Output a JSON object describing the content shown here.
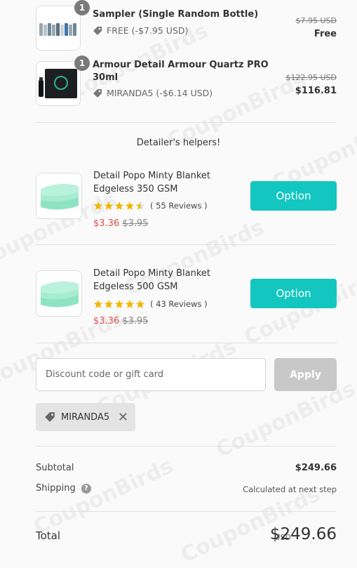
{
  "order_items": [
    {
      "qty": "1",
      "title": "Sampler (Single Random Bottle)",
      "discount": "FREE (-$7.95 USD)",
      "old_price": "$7.95 USD",
      "price": "Free"
    },
    {
      "qty": "1",
      "title_line1": "Armour Detail Armour Quartz PRO",
      "title_line2": "30ml",
      "discount": "MIRANDA5 (-$6.14 USD)",
      "old_price": "$122.95 USD",
      "price": "$116.81"
    }
  ],
  "helpers": {
    "title": "Detailer's helpers!",
    "items": [
      {
        "title_line1": "Detail Popo Minty Blanket",
        "title_line2": "Edgeless 350 GSM",
        "rating": 4.5,
        "reviews": "( 55 Reviews )",
        "sale_price": "$3.36",
        "was_price": "$3.95",
        "button": "Option"
      },
      {
        "title_line1": "Detail Popo Minty Blanket",
        "title_line2": "Edgeless 500 GSM",
        "rating": 5,
        "reviews": "( 43 Reviews )",
        "sale_price": "$3.36",
        "was_price": "$3.95",
        "button": "Option"
      }
    ]
  },
  "discount_form": {
    "placeholder": "Discount code or gift card",
    "apply_label": "Apply",
    "applied_code": "MIRANDA5"
  },
  "summary": {
    "subtotal_label": "Subtotal",
    "subtotal_value": "$249.66",
    "shipping_label": "Shipping",
    "shipping_value": "Calculated at next step",
    "total_label": "Total",
    "total_currency": "USD",
    "total_value": "$249.66"
  },
  "watermark": "CouponBirds",
  "colors": {
    "option_button": "#13c6c0",
    "star": "#f2b705",
    "sale_price": "#e14c4c"
  }
}
